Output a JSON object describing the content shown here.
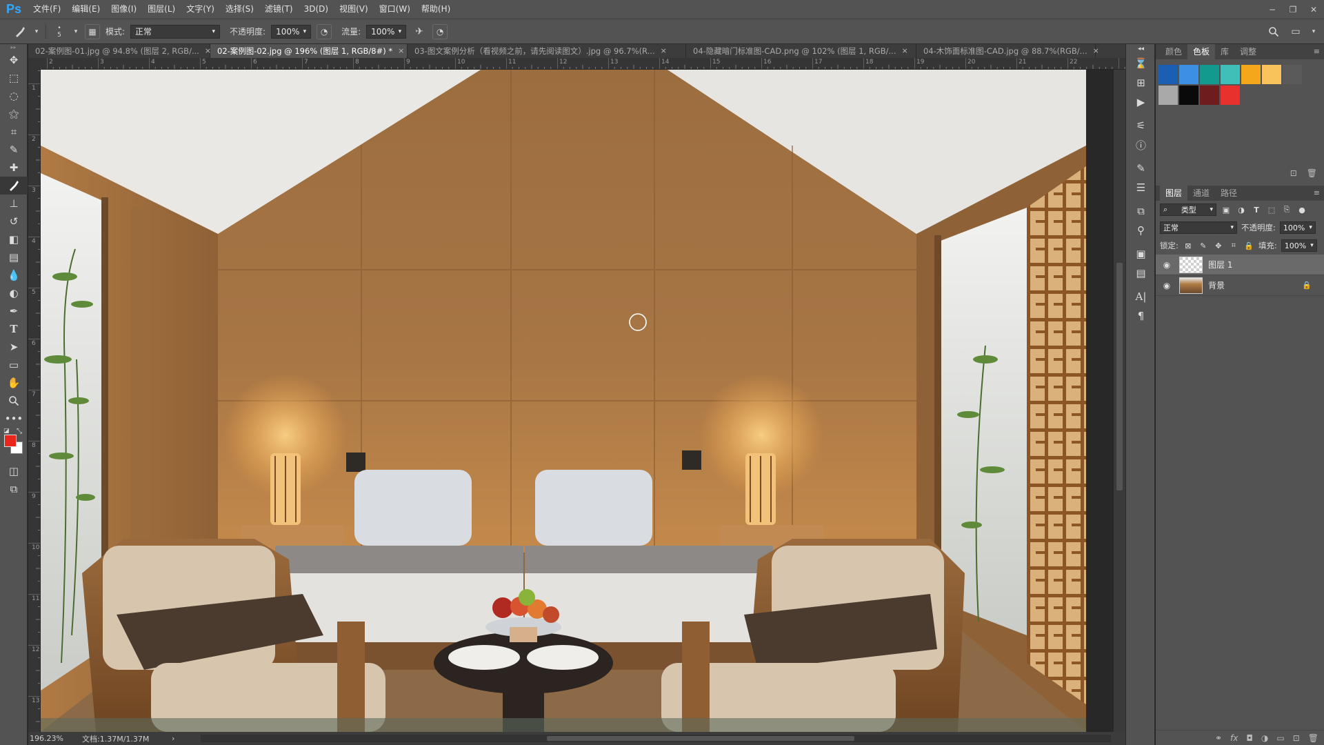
{
  "app": {
    "logo": "Ps"
  },
  "menu": [
    "文件(F)",
    "编辑(E)",
    "图像(I)",
    "图层(L)",
    "文字(Y)",
    "选择(S)",
    "滤镜(T)",
    "3D(D)",
    "视图(V)",
    "窗口(W)",
    "帮助(H)"
  ],
  "window_controls": {
    "minimize": "−",
    "restore": "❐",
    "close": "✕"
  },
  "options": {
    "brush_size": "5",
    "mode_label": "模式:",
    "mode_value": "正常",
    "opacity_label": "不透明度:",
    "opacity_value": "100%",
    "flow_label": "流量:",
    "flow_value": "100%"
  },
  "tabs": [
    {
      "label": "02-案例图-01.jpg @ 94.8% (图层 2, RGB/...",
      "close": "×"
    },
    {
      "label": "02-案例图-02.jpg @ 196% (图层 1, RGB/8#) *",
      "close": "×",
      "active": true
    },
    {
      "label": "03-图文案例分析（看视频之前，请先阅读图文）.jpg @ 96.7%(R...",
      "close": "×"
    },
    {
      "label": "04-隐藏暗门标准图-CAD.png @ 102% (图层 1, RGB/...",
      "close": "×"
    },
    {
      "label": "04-木饰面标准图-CAD.jpg @ 88.7%(RGB/...",
      "close": "×"
    }
  ],
  "ruler_h": [
    "2",
    "3",
    "4",
    "5",
    "6",
    "7",
    "8",
    "9",
    "10",
    "11",
    "12",
    "13",
    "14",
    "15",
    "16",
    "17",
    "18",
    "19",
    "20",
    "21",
    "22"
  ],
  "ruler_v": [
    "1",
    "2",
    "3",
    "4",
    "5",
    "6",
    "7",
    "8",
    "9",
    "10",
    "11",
    "12",
    "13"
  ],
  "status": {
    "zoom": "196.23%",
    "doc": "文档:1.37M/1.37M",
    "arrow": "›"
  },
  "colors": {
    "foreground": "#e8261c",
    "background": "#ffffff"
  },
  "right_panel": {
    "top_tabs": [
      "颜色",
      "色板",
      "库",
      "调整"
    ],
    "swatches": [
      "#1a5fb4",
      "#3d8fe6",
      "#129a8f",
      "#3fbfb8",
      "#f5a71c",
      "#f9c35b",
      "#5a5a5a",
      "#a9a9a9",
      "#0a0a0a",
      "#6e1c1c",
      "#e8312d"
    ],
    "layer_tabs": [
      "图层",
      "通道",
      "路径"
    ],
    "filter_label": "类型",
    "blend_mode": "正常",
    "opacity_label": "不透明度:",
    "opacity_value": "100%",
    "lock_label": "锁定:",
    "fill_label": "填充:",
    "fill_value": "100%",
    "layers": [
      {
        "name": "图层 1",
        "selected": true
      },
      {
        "name": "背景",
        "locked": true
      }
    ]
  }
}
